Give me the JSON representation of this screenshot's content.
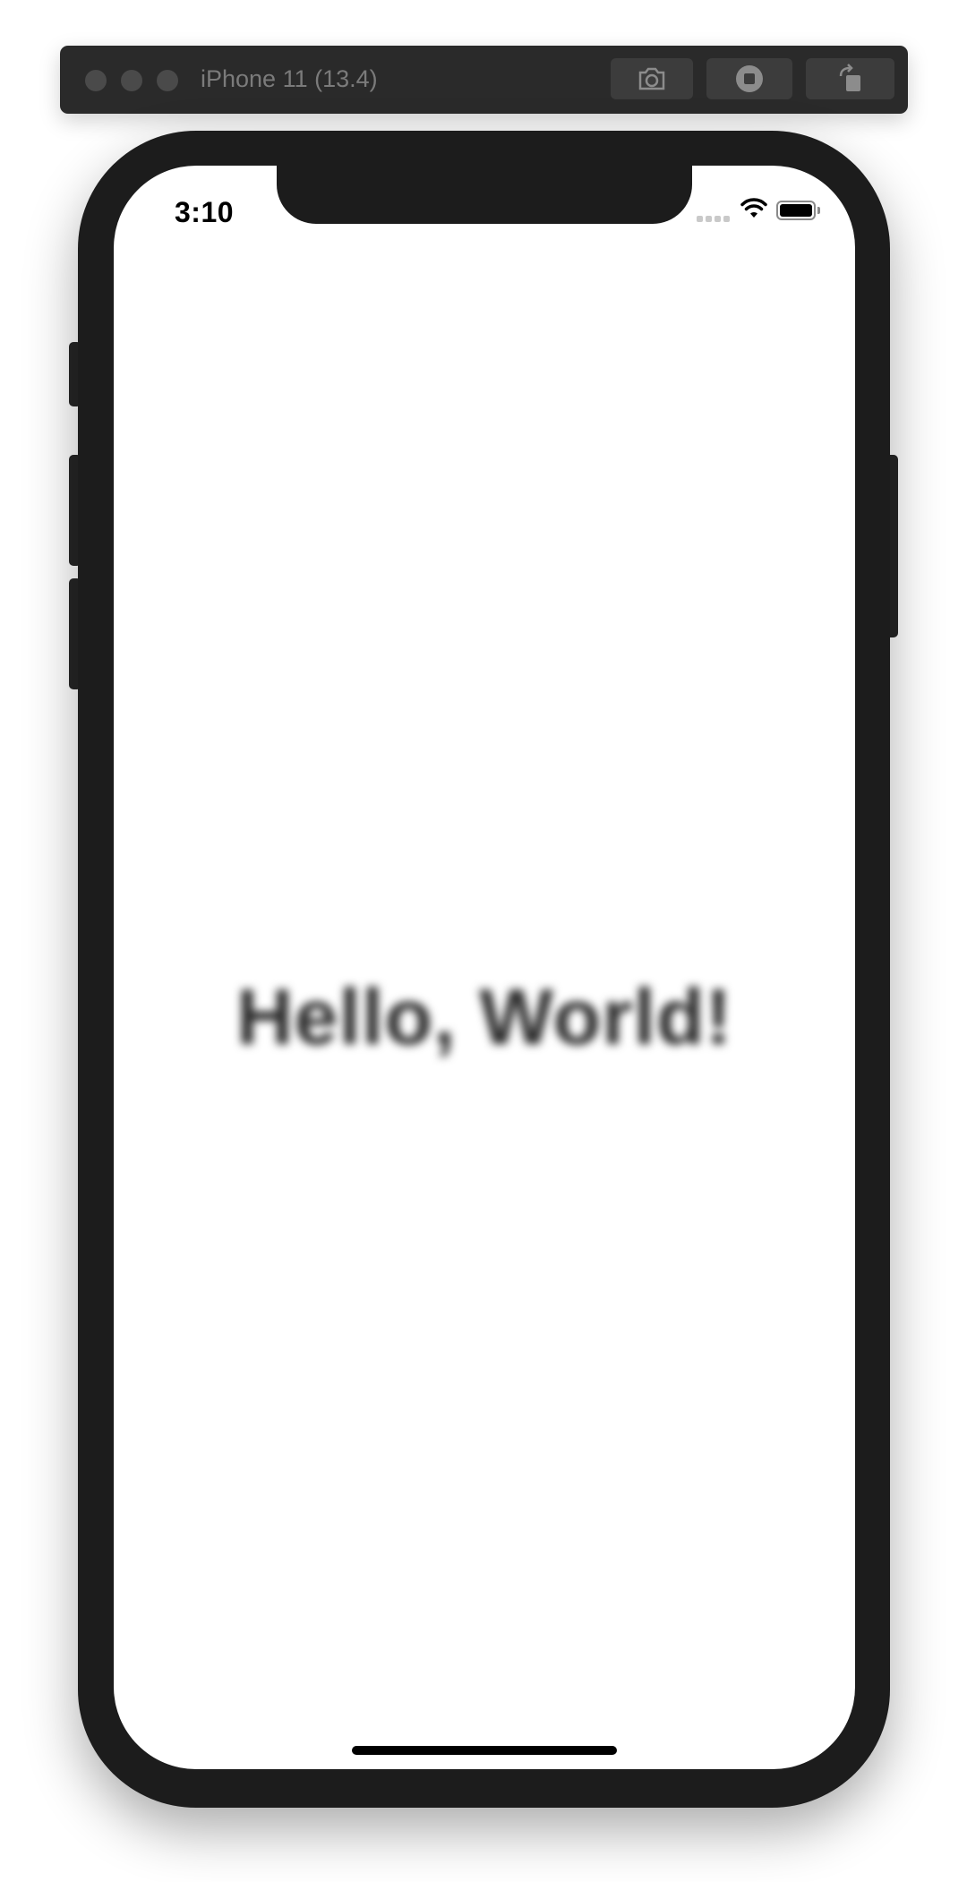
{
  "window": {
    "title": "iPhone 11 (13.4)",
    "toolbar": {
      "screenshot_icon": "camera-icon",
      "home_icon": "home-button-icon",
      "rotate_icon": "rotate-icon"
    }
  },
  "status_bar": {
    "time": "3:10",
    "signal_icon": "cellular-signal-icon",
    "wifi_icon": "wifi-icon",
    "battery_icon": "battery-icon",
    "battery_level": 1.0
  },
  "content": {
    "text": "Hello, World!"
  },
  "colors": {
    "titlebar": "#2a2a2a",
    "device_frame": "#1c1c1c",
    "screen": "#ffffff",
    "text": "#2b2b2b"
  }
}
